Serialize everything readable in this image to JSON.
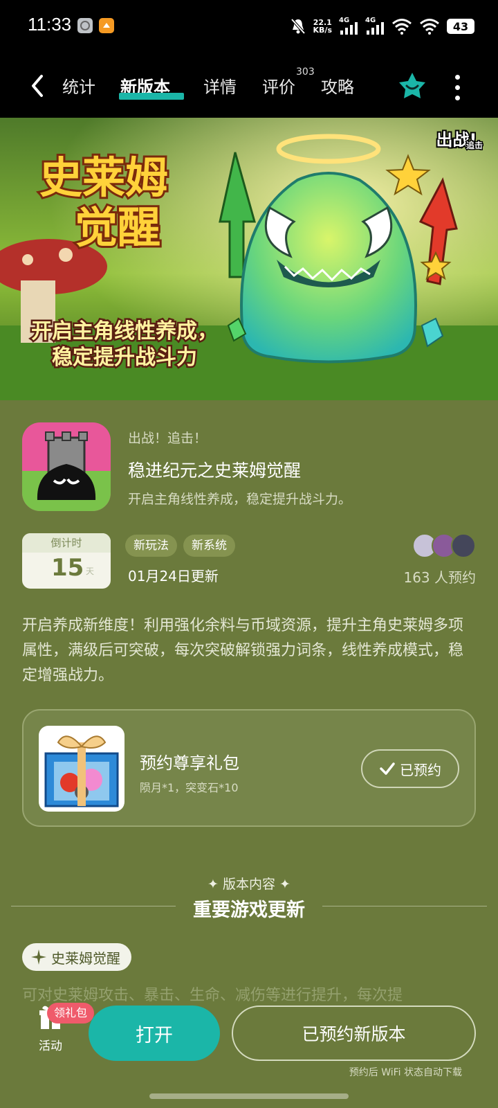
{
  "status_bar": {
    "time": "11:33",
    "net_speed_value": "22.1",
    "net_speed_unit": "KB/s",
    "signal1_label": "4G",
    "signal2_label": "4G",
    "battery": "43",
    "icons": [
      "app-icon-gray",
      "app-icon-orange",
      "mute-bell-icon",
      "signal-icon",
      "signal-icon",
      "wifi-icon",
      "wifi-icon",
      "battery-icon"
    ]
  },
  "nav": {
    "tabs": [
      {
        "label": "统计"
      },
      {
        "label": "新版本",
        "active": true
      },
      {
        "label": "详情"
      },
      {
        "label": "评价",
        "badge": "303"
      },
      {
        "label": "攻略"
      }
    ],
    "accent_color": "#1bb6a8"
  },
  "banner": {
    "title_line1": "史莱姆",
    "title_line2": "觉醒",
    "subtitle_line1": "开启主角线性养成，",
    "subtitle_line2": "稳定提升战斗力",
    "logo_line1": "出战!",
    "logo_line2": "追击"
  },
  "game": {
    "developer": "出战！追击！",
    "title": "稳进纪元之史莱姆觉醒",
    "subtitle": "开启主角线性养成，稳定提升战斗力。",
    "countdown_label": "倒计时",
    "countdown_value": "15",
    "countdown_unit": "天",
    "tags": [
      "新玩法",
      "新系统"
    ],
    "update_date": "01月24日更新",
    "reserve_count": "163 人预约",
    "description": "开启养成新维度！利用强化余料与币域资源，提升主角史莱姆多项属性，满级后可突破，每次突破解锁强力词条，线性养成模式，稳定增强战力。"
  },
  "gift": {
    "title": "预约尊享礼包",
    "content": "陨月*1，突变石*10",
    "button": "已预约"
  },
  "section": {
    "label": "版本内容",
    "title": "重要游戏更新",
    "feature_chip": "史莱姆觉醒",
    "feature_text": "可对史莱姆攻击、暴击、生命、减伤等进行提升，每次提"
  },
  "bottom": {
    "activity_label": "活动",
    "gift_badge": "领礼包",
    "open_button": "打开",
    "reserve_button": "已预约新版本",
    "wifi_note": "预约后 WiFi 状态自动下载"
  }
}
